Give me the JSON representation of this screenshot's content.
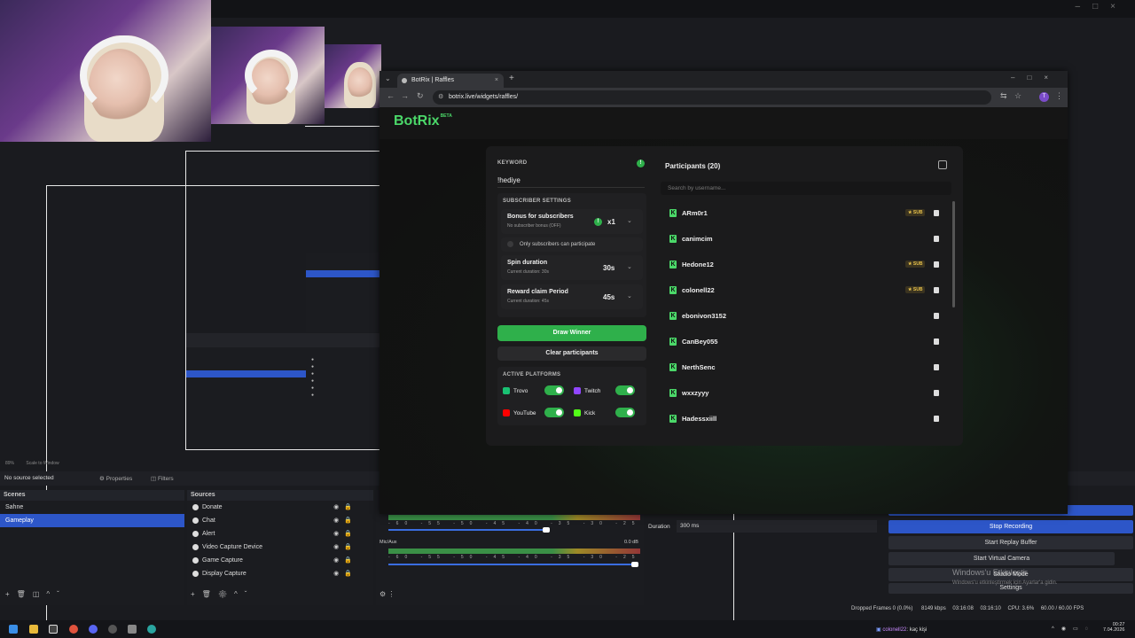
{
  "obs": {
    "zoom": "89%",
    "scale_label": "Scale to Window",
    "no_source": "No source selected",
    "properties_label": "Properties",
    "filters_label": "Filters",
    "scenes_header": "Scenes",
    "sources_header": "Sources",
    "scenes": [
      {
        "label": "Sahne",
        "selected": false
      },
      {
        "label": "Gameplay",
        "selected": true
      }
    ],
    "sources": [
      "Donate",
      "Chat",
      "Alert",
      "Video Capture Device",
      "Game Capture",
      "Display Capture"
    ],
    "mixer": {
      "track2_label": "Mic/Aux",
      "track2_db": "0.0 dB",
      "ticks": "-60 -55 -50 -45 -40 -35 -30 -25 -20 -15 -10 -5 0"
    },
    "transition": {
      "duration_label": "Duration",
      "duration_value": "300 ms"
    },
    "controls": {
      "stop_recording": "Stop Recording",
      "replay_buffer": "Start Replay Buffer",
      "virtual_camera": "Start Virtual Camera",
      "studio_mode": "Studio Mode",
      "settings": "Settings"
    },
    "status": {
      "dropped_frames": "Dropped Frames 0 (0.0%)",
      "bitrate": "8149 kbps",
      "stream_time": "03:16:08",
      "rec_time": "03:16:10",
      "cpu": "CPU: 3.6%",
      "fps": "60.00 / 60.00 FPS"
    },
    "watermark_title": "Windows'u Etkinleştir",
    "watermark_sub": "Windows'u etkinleştirmek için Ayarlar'a gidin."
  },
  "browser": {
    "tab_title": "BotRix | Raffles",
    "url": "botrix.live/widgets/raffles/",
    "profile_initial": "T"
  },
  "botrix": {
    "logo": "BotRix",
    "logo_badge": "BETA",
    "keyword_label": "KEYWORD",
    "keyword_value": "!hediye",
    "sub_settings_label": "SUBSCRIBER SETTINGS",
    "bonus": {
      "title": "Bonus for subscribers",
      "sub": "No subscriber bonus (OFF)",
      "value": "x1"
    },
    "only_subs": "Only subscribers can participate",
    "spin": {
      "title": "Spin duration",
      "sub": "Current duration: 30s",
      "value": "30s"
    },
    "reward": {
      "title": "Reward claim Period",
      "sub": "Current duration: 45s",
      "value": "45s"
    },
    "draw_winner": "Draw Winner",
    "clear_participants": "Clear participants",
    "active_platforms_label": "ACTIVE PLATFORMS",
    "platforms": [
      {
        "name": "Trovo",
        "on": true,
        "color": "#19c173"
      },
      {
        "name": "Twitch",
        "on": true,
        "color": "#9146ff"
      },
      {
        "name": "YouTube",
        "on": true,
        "color": "#ff0000"
      },
      {
        "name": "Kick",
        "on": true,
        "color": "#53fc18"
      }
    ],
    "participants_title": "Participants (20)",
    "search_placeholder": "Search by username...",
    "sub_badge": "SUB",
    "participants": [
      {
        "name": "ARm0r1",
        "sub": true
      },
      {
        "name": "canimcim",
        "sub": false
      },
      {
        "name": "Hedone12",
        "sub": true
      },
      {
        "name": "colonell22",
        "sub": true
      },
      {
        "name": "ebonivon3152",
        "sub": false
      },
      {
        "name": "CanBey055",
        "sub": false
      },
      {
        "name": "NerthSenc",
        "sub": false
      },
      {
        "name": "wxxzyyy",
        "sub": false
      },
      {
        "name": "Hadessxiill",
        "sub": false
      }
    ],
    "accent": "#4bd869"
  },
  "taskbar": {
    "chat_user": "colonell22",
    "chat_msg": ": kaç kişi",
    "time": "00:27",
    "date": "7.04.2026"
  }
}
